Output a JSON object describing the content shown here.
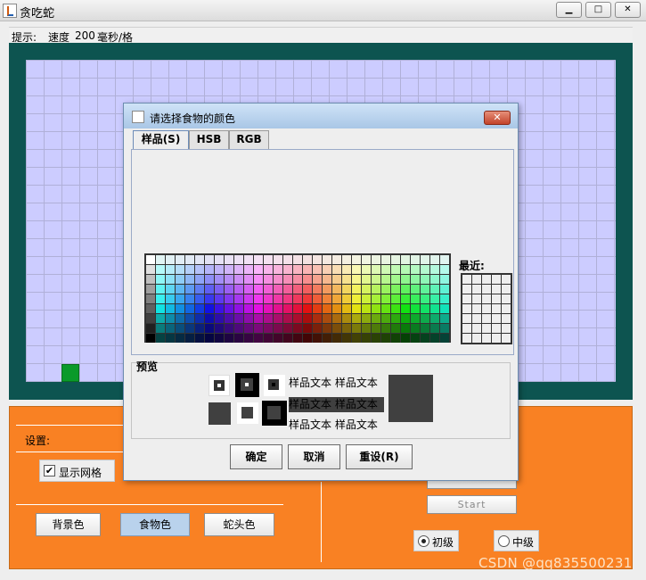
{
  "window": {
    "title": "贪吃蛇",
    "controls": [
      "minimize-icon",
      "maximize-icon",
      "close-icon"
    ]
  },
  "infobar": {
    "label": "提示:",
    "speed_label": "速度",
    "speed_value": "200",
    "speed_unit": "毫秒/格"
  },
  "panel": {
    "settings_label": "设置:",
    "show_grid_label": "显示网格",
    "show_grid_checked": true,
    "buttons": {
      "background_color": "背景色",
      "food_color": "食物色",
      "snake_head_color": "蛇头色",
      "start": "Start"
    },
    "levels": [
      {
        "label": "初级",
        "selected": true
      },
      {
        "label": "中级",
        "selected": false
      }
    ]
  },
  "dialog": {
    "title": "请选择食物的颜色",
    "tabs": [
      "样品(S)",
      "HSB",
      "RGB"
    ],
    "recent_label": "最近:",
    "preview_label": "预览",
    "sample_text": "样品文本",
    "buttons": {
      "ok": "确定",
      "cancel": "取消",
      "reset": "重设(R)"
    }
  },
  "colors": {
    "board_background": "#ccccff",
    "board_border": "#0d5450",
    "food": "#0a9a2a",
    "panel_background": "#f98123",
    "preview_color": "#404040"
  },
  "watermark": "CSDN @qq835500231"
}
